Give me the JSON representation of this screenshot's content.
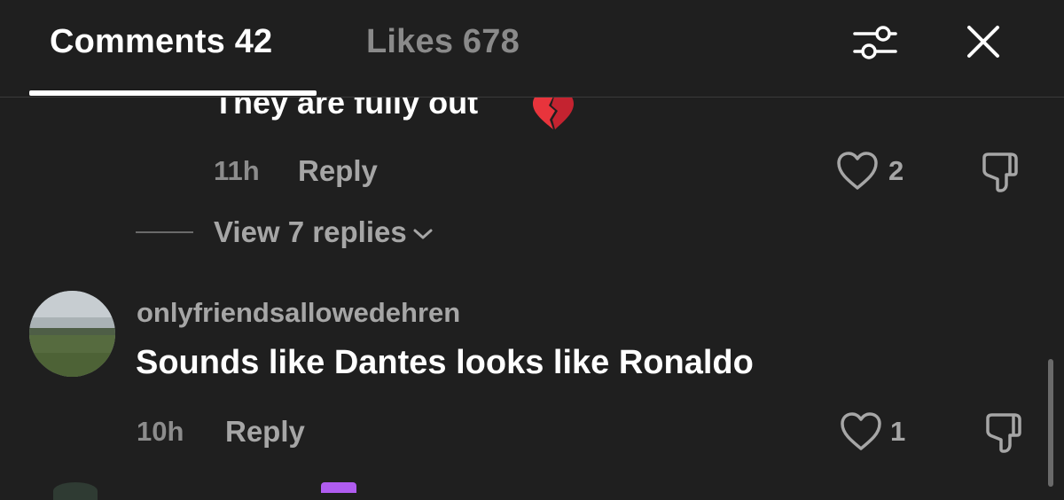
{
  "tabs": [
    {
      "label": "Comments 42",
      "active": true
    },
    {
      "label": "Likes 678",
      "active": false
    }
  ],
  "header_icons": {
    "filter": "filter-sliders-icon",
    "close": "close-icon"
  },
  "comments": [
    {
      "text": "They are fully out",
      "emoji": "broken-heart-icon",
      "time": "11h",
      "reply_label": "Reply",
      "likes": "2",
      "view_replies": "View 7 replies"
    },
    {
      "username": "onlyfriendsallowedehren",
      "text": "Sounds like Dantes looks like Ronaldo",
      "time": "10h",
      "reply_label": "Reply",
      "likes": "1"
    }
  ],
  "colors": {
    "background": "#1f1f1f",
    "primary_text": "#ffffff",
    "secondary_text": "#a6a6a6",
    "muted_text": "#8c8c8c"
  }
}
